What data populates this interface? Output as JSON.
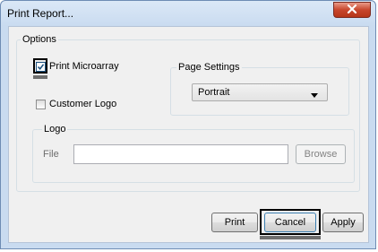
{
  "window": {
    "title": "Print Report..."
  },
  "options": {
    "legend": "Options",
    "print_microarray": {
      "label": "Print Microarray",
      "checked": true
    },
    "customer_logo": {
      "label": "Customer Logo",
      "checked": false
    },
    "page_settings": {
      "legend": "Page Settings",
      "selected": "Portrait"
    },
    "logo": {
      "legend": "Logo",
      "file_label": "File",
      "file_value": "",
      "browse_label": "Browse"
    }
  },
  "buttons": {
    "print": "Print",
    "cancel": "Cancel",
    "apply": "Apply"
  },
  "colors": {
    "accent": "#1c5180",
    "close": "#c8462c"
  },
  "icons": {
    "close": "close-icon",
    "check": "checkmark-icon",
    "dropdown": "chevron-down-icon"
  }
}
